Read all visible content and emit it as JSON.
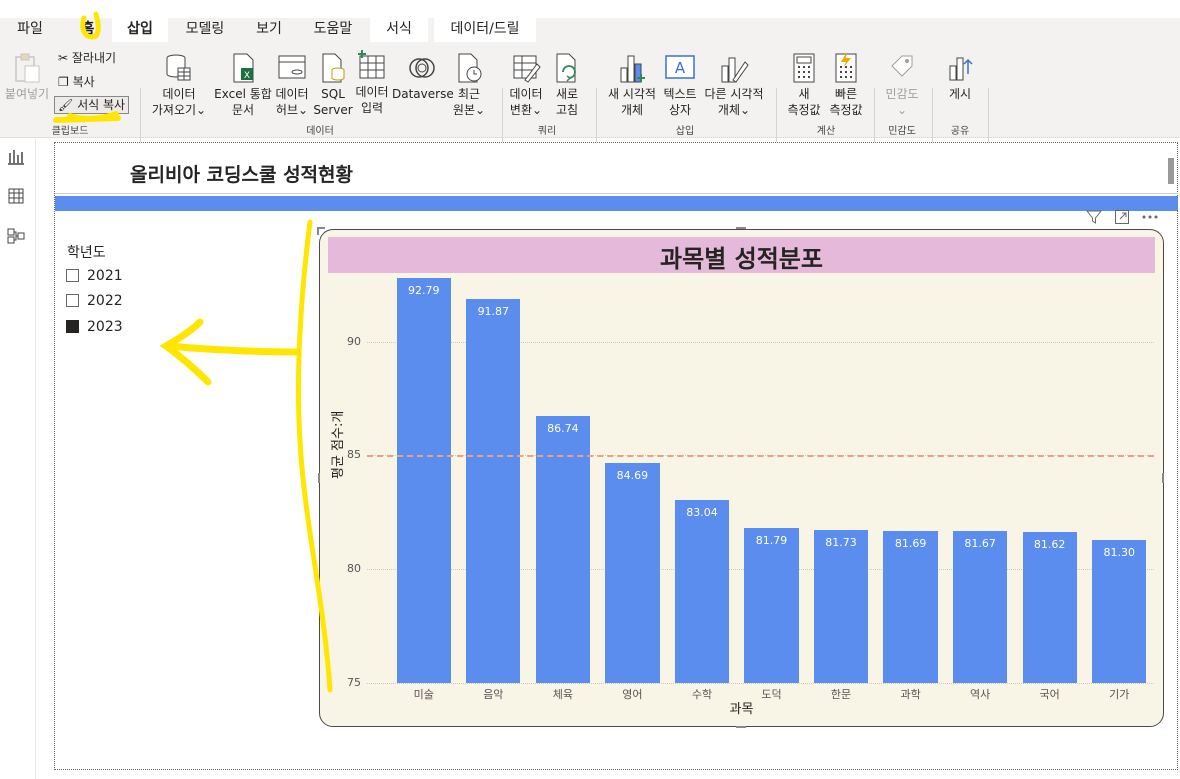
{
  "tabs": [
    {
      "label": "파일",
      "active": false
    },
    {
      "label": "홈",
      "active": false
    },
    {
      "label": "삽입",
      "active": true
    },
    {
      "label": "모델링",
      "active": false
    },
    {
      "label": "보기",
      "active": false
    },
    {
      "label": "도움말",
      "active": false
    },
    {
      "label": "서식",
      "active": true
    },
    {
      "label": "데이터/드릴",
      "active": true
    }
  ],
  "ribbon": {
    "clipboard": {
      "paste": "붙여넣기",
      "cut": "잘라내기",
      "copy": "복사",
      "format_painter": "서식 복사",
      "group": "클립보드"
    },
    "data": {
      "get_data": [
        "데이터",
        "가져오기⌄"
      ],
      "excel": [
        "Excel 통합",
        "문서"
      ],
      "data_hub": [
        "데이터",
        "허브⌄"
      ],
      "sql": [
        "SQL",
        "Server"
      ],
      "enter_data": [
        "데이터",
        "입력"
      ],
      "dataverse": [
        "Dataverse",
        ""
      ],
      "recent": [
        "최근",
        "원본⌄"
      ],
      "group": "데이터"
    },
    "query": {
      "transform": [
        "데이터",
        "변환⌄"
      ],
      "refresh": [
        "새로",
        "고침"
      ],
      "group": "쿼리"
    },
    "insert": {
      "new_visual": [
        "새 시각적",
        "개체"
      ],
      "textbox": [
        "텍스트",
        "상자"
      ],
      "more_visuals": [
        "다른 시각적",
        "개체⌄"
      ],
      "group": "삽입"
    },
    "calc": {
      "new_measure": [
        "새",
        "측정값"
      ],
      "quick_measure": [
        "빠른",
        "측정값"
      ],
      "group": "계산"
    },
    "sensitivity": {
      "label": "민감도",
      "chevron": "⌄",
      "group": "민감도"
    },
    "share": {
      "publish": "게시",
      "group": "공유"
    }
  },
  "report": {
    "title": "올리비아 코딩스쿨 성적현황",
    "slicer": {
      "title": "학년도",
      "items": [
        {
          "label": "2021",
          "checked": false
        },
        {
          "label": "2022",
          "checked": false
        },
        {
          "label": "2023",
          "checked": true
        }
      ]
    }
  },
  "colors": {
    "bar": "#5b8def",
    "title_bg": "#e5b9da",
    "plot_bg": "#f8f5e6",
    "avg_line": "#e8a27f",
    "annotation": "#ffe600"
  },
  "chart_data": {
    "type": "bar",
    "title": "과목별 성적분포",
    "xlabel": "과목",
    "ylabel": "평균 점수:개",
    "categories": [
      "미술",
      "음악",
      "체육",
      "영어",
      "수학",
      "도덕",
      "한문",
      "과학",
      "역사",
      "국어",
      "기가"
    ],
    "values": [
      92.79,
      91.87,
      86.74,
      84.69,
      83.04,
      81.79,
      81.73,
      81.69,
      81.67,
      81.62,
      81.3
    ],
    "value_labels": [
      "92.79",
      "91.87",
      "86.74",
      "84.69",
      "83.04",
      "81.79",
      "81.73",
      "81.69",
      "81.67",
      "81.62",
      "81.30"
    ],
    "ylim": [
      75,
      94.6
    ],
    "yticks": [
      75,
      80,
      85,
      90
    ],
    "ytick_labels": [
      "75",
      "80",
      "85",
      "90"
    ],
    "average_line": 85,
    "grid": true
  }
}
